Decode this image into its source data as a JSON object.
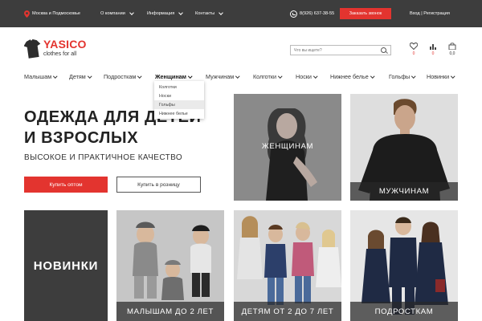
{
  "topbar": {
    "location": "Москва и Подмосковье",
    "menu": [
      {
        "label": "О компании"
      },
      {
        "label": "Информация"
      },
      {
        "label": "Контакты"
      }
    ],
    "phone": "8(926) 637-38-55",
    "callback_label": "Заказать звонок",
    "auth": "Вход | Регистрация"
  },
  "logo": {
    "name": "YASICO",
    "tagline": "clothes for all"
  },
  "search": {
    "placeholder": "Что вы ищете?"
  },
  "header_icons": {
    "favorites_count": "0",
    "compare_count": "0",
    "cart_count": "0,0"
  },
  "nav": {
    "items": [
      {
        "label": "Малышам"
      },
      {
        "label": "Детям"
      },
      {
        "label": "Подросткам"
      },
      {
        "label": "Женщинам"
      },
      {
        "label": "Мужчинам"
      },
      {
        "label": "Колготки"
      },
      {
        "label": "Носки"
      },
      {
        "label": "Нижнее белье"
      },
      {
        "label": "Гольфы"
      },
      {
        "label": "Новинки"
      }
    ],
    "active": "Женщинам",
    "dropdown": [
      "Колготки",
      "Носки",
      "Гольфы",
      "Нижнее белье"
    ]
  },
  "hero": {
    "title": "ОДЕЖДА ДЛЯ ДЕТЕЙ\nИ ВЗРОСЛЫХ",
    "subtitle": "ВЫСОКОЕ И ПРАКТИЧНОЕ КАЧЕСТВО",
    "wholesale_label": "Купить оптом",
    "retail_label": "Купить в розницу"
  },
  "categories": {
    "women": "ЖЕНЩИНАМ",
    "men": "МУЖЧИНАМ",
    "new": "НОВИНКИ",
    "babies": "МАЛЫШАМ ДО 2 ЛЕТ",
    "kids": "ДЕТЯМ ОТ 2 ДО 7 ЛЕТ",
    "teens": "ПОДРОСТКАМ"
  },
  "colors": {
    "accent": "#e3342f",
    "dark": "#3d3d3d"
  }
}
